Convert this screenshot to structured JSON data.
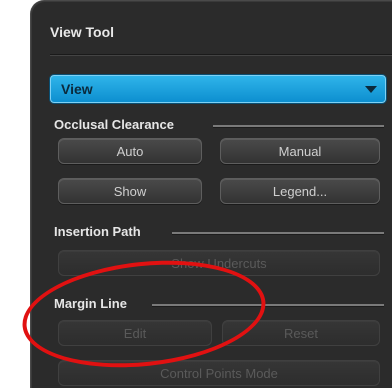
{
  "panel": {
    "title": "View Tool",
    "view_dropdown": {
      "selected": "View"
    }
  },
  "occlusal_clearance": {
    "title": "Occlusal Clearance",
    "auto_label": "Auto",
    "manual_label": "Manual",
    "show_label": "Show",
    "legend_label": "Legend..."
  },
  "insertion_path": {
    "title": "Insertion Path",
    "show_undercuts_label": "Show Undercuts"
  },
  "margin_line": {
    "title": "Margin Line",
    "edit_label": "Edit",
    "reset_label": "Reset",
    "control_points_label": "Control Points Mode"
  },
  "colors": {
    "panel_bg": "#2b2b2b",
    "accent_blue": "#1aa3e0",
    "annotation_red": "#e11111"
  }
}
